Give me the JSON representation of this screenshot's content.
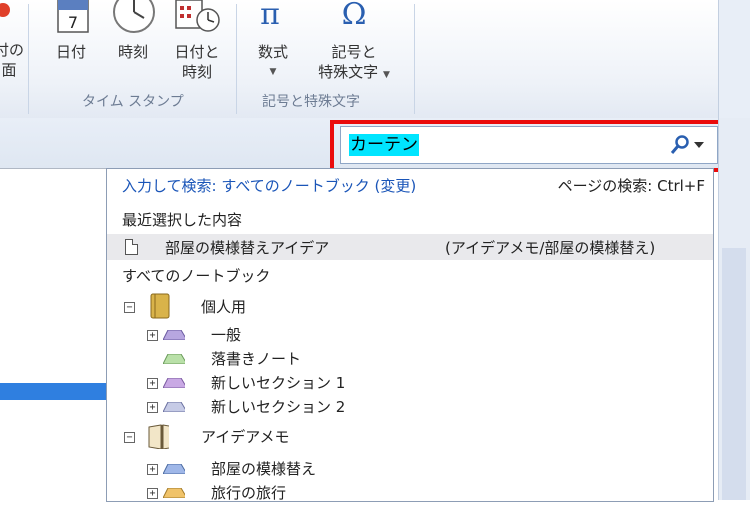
{
  "ribbon": {
    "partial_left": [
      "付の",
      "面"
    ],
    "buttons": {
      "date": "日付",
      "time": "時刻",
      "date_time_1": "日付と",
      "date_time_2": "時刻",
      "equation": "数式",
      "symbol_1": "記号と",
      "symbol_2": "特殊文字"
    },
    "calendar_day": "7",
    "group_time": "タイム スタンプ",
    "group_symbols": "記号と特殊文字"
  },
  "search": {
    "value": "カーテン",
    "highlight_color": "#00e5ff",
    "callout_color": "#ea0b0b"
  },
  "panel": {
    "scope_link": "入力して検索: すべてのノートブック (変更)",
    "page_search": "ページの検索: Ctrl+F",
    "recent_header": "最近選択した内容",
    "recent_item": {
      "name": "部屋の模様替えアイデア",
      "path": "(アイデアメモ/部屋の模様替え)"
    },
    "all_header": "すべてのノートブック",
    "notebooks": [
      {
        "name": "個人用",
        "sections": [
          {
            "name": "一般",
            "color": "#b7a6e0",
            "expand": "+"
          },
          {
            "name": "落書きノート",
            "color": "#b9e0a8",
            "expand": ""
          },
          {
            "name": "新しいセクション 1",
            "color": "#c9a9e4",
            "expand": "+"
          },
          {
            "name": "新しいセクション 2",
            "color": "#c6cbe6",
            "expand": "+"
          }
        ]
      },
      {
        "name": "アイデアメモ",
        "sections": [
          {
            "name": "部屋の模様替え",
            "color": "#9fb7e8",
            "expand": "+"
          },
          {
            "name": "旅行の旅行",
            "color": "#f0c36a",
            "expand": "+"
          }
        ]
      }
    ],
    "collapse_glyph": "−"
  }
}
